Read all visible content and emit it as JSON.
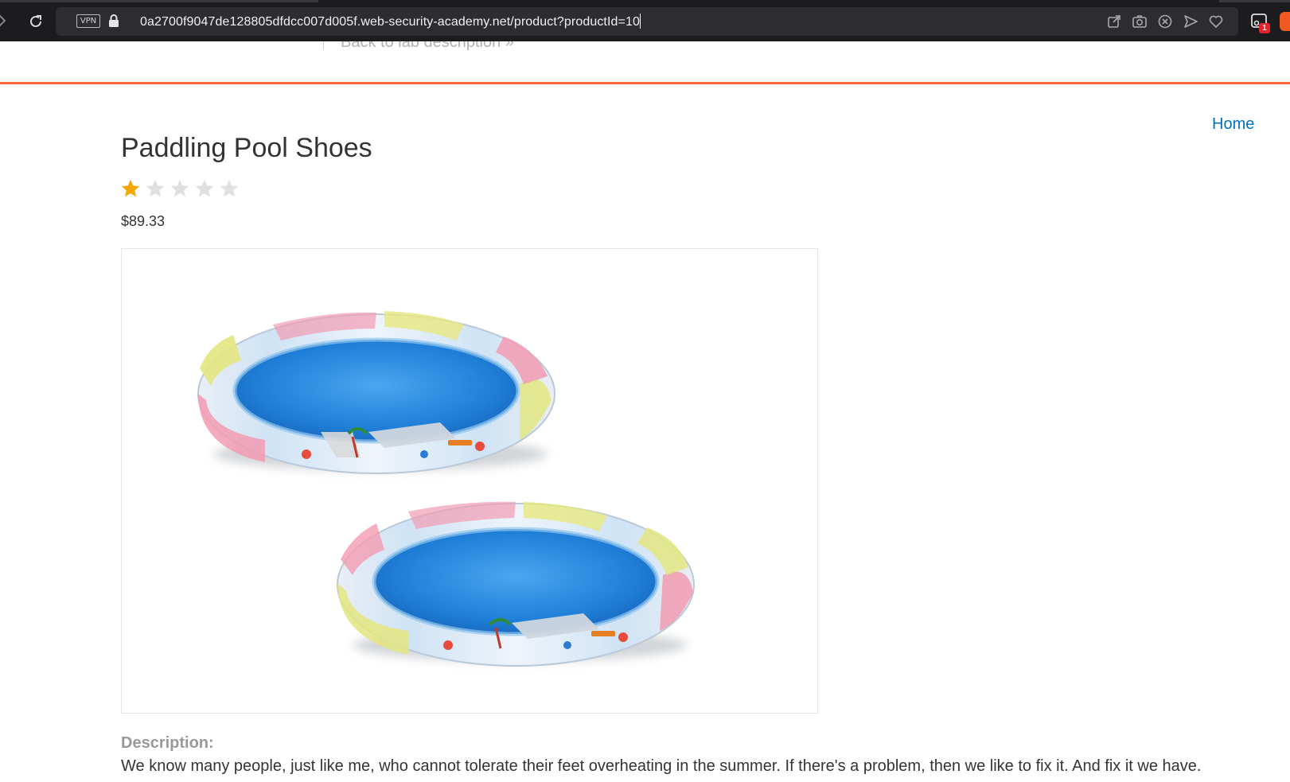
{
  "browser": {
    "url": "0a2700f9047de128805dfdcc007d005f.web-security-academy.net/product?productId=10",
    "vpn_label": "VPN",
    "extension_badge": "1",
    "icons": [
      "back-arrow-icon",
      "reload-icon",
      "lock-icon",
      "share-icon",
      "camera-icon",
      "close-circle-icon",
      "send-icon",
      "heart-icon",
      "extensions-icon"
    ]
  },
  "lab_header": {
    "back_link": "Back to lab description »"
  },
  "nav": {
    "home": "Home"
  },
  "product": {
    "title": "Paddling Pool Shoes",
    "rating": {
      "value": 1,
      "max": 5
    },
    "price": "$89.33",
    "image_alt": "Two inflatable paddling pools",
    "description_label": "Description:",
    "description": "We know many people, just like me, who cannot tolerate their feet overheating in the summer. If there's a problem, then we like to fix it. And fix it we have."
  },
  "colors": {
    "accent_orange": "#ff6633",
    "link_blue": "#0071bc",
    "star_filled": "#f7a600",
    "star_empty": "#e0e0e0",
    "browser_dark": "#1c1c1f"
  }
}
